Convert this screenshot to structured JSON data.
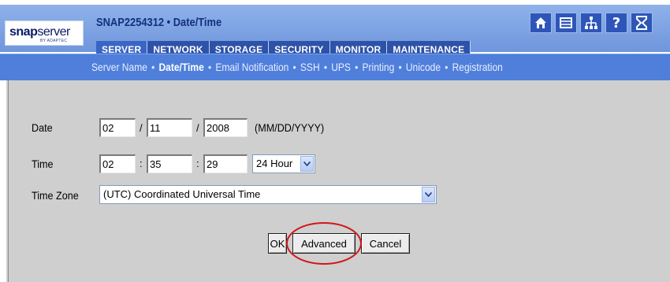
{
  "header": {
    "logo_bold": "snap",
    "logo_thin": "server",
    "logo_sub": "BY ADAPTEC",
    "title": "SNAP2254312 • Date/Time",
    "icons": [
      "home-icon",
      "server-icon",
      "network-icon",
      "help-icon",
      "hourglass-icon"
    ]
  },
  "tabs": [
    {
      "label": "SERVER",
      "active": true
    },
    {
      "label": "NETWORK"
    },
    {
      "label": "STORAGE"
    },
    {
      "label": "SECURITY"
    },
    {
      "label": "MONITOR"
    },
    {
      "label": "MAINTENANCE"
    }
  ],
  "subnav": {
    "items": [
      "Server Name",
      "Date/Time",
      "Email Notification",
      "SSH",
      "UPS",
      "Printing",
      "Unicode",
      "Registration"
    ],
    "active": "Date/Time",
    "separator": "•"
  },
  "form": {
    "date_label": "Date",
    "date_month": "02",
    "date_day": "11",
    "date_year": "2008",
    "date_sep": "/",
    "date_format": "(MM/DD/YYYY)",
    "time_label": "Time",
    "time_hour": "02",
    "time_minute": "35",
    "time_second": "29",
    "time_sep": ":",
    "time_mode": "24 Hour",
    "timezone_label": "Time Zone",
    "timezone_value": "(UTC) Coordinated Universal Time"
  },
  "buttons": {
    "ok": "OK",
    "advanced": "Advanced",
    "cancel": "Cancel"
  },
  "colors": {
    "header_blue": "#6f95dc",
    "tab_blue": "#2d52a8",
    "subnav_blue": "#4f7fdb",
    "content_grey": "#cfcfcf",
    "highlight_red": "#d01818"
  }
}
